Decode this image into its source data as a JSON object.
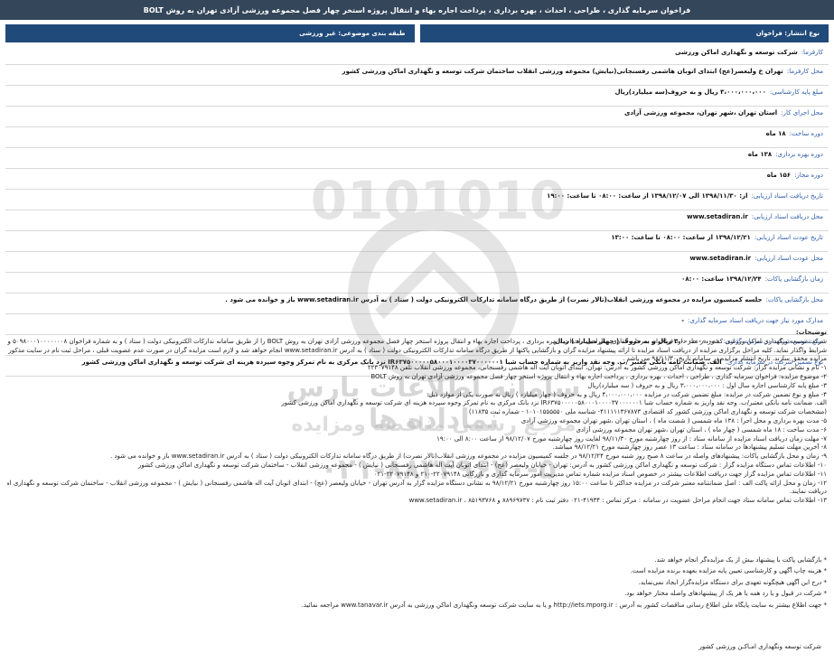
{
  "header": {
    "title": "فراخوان سرمایه گذاری ، طراحی ، احداث ، بهره برداری ، پرداخت اجاره بهاء و انتقال پروژه استخر چهار فصل مجموعه ورزشی آزادی تهران به روش BOLT"
  },
  "tabs": {
    "right": "نوع انتشار: فراخوان",
    "left": "طبقه بندی موضوعی: غیر ورزشی"
  },
  "fields": [
    {
      "label": "کارفرما:",
      "value": "شرکت توسعه و نگهداری اماکن ورزشی"
    },
    {
      "label": "محل کارفرما:",
      "value": "تهران خ ولیعصر(عج) ابتدای اتوبان هاشمی رفسنجانی(نیایش) مجموعه ورزشی انقلاب ساختمان شرکت توسعه و نگهداری اماکن ورزشی کشور"
    },
    {
      "label": "مبلغ پایه کارشناسی:",
      "value": "۳،۰۰۰،۰۰۰،۰۰۰ ریال و به حروف(سه میلیارد)ریال"
    },
    {
      "label": "محل اجرای کار:",
      "value": "استان تهران ،شهر تهران، مجموعه ورزشی آزادی"
    },
    {
      "label": "دوره ساخت:",
      "value": "۱۸ ماه"
    },
    {
      "label": "دوره بهره برداری:",
      "value": "۱۳۸ ماه"
    },
    {
      "label": "دوره مجاز:",
      "value": "۱۵۶ ماه"
    },
    {
      "label": "تاریخ دریافت اسناد ارزیابی:",
      "value": "از: ۱۳۹۸/۱۱/۳۰ الی ۱۳۹۸/۱۲/۰۷ از ساعت: ۰۸:۰۰ تا ساعت: ۱۹:۰۰"
    },
    {
      "label": "محل دریافت اسناد ارزیابی:",
      "value": "www.setadiran.ir"
    },
    {
      "label": "تاریخ عودت اسناد ارزیابی:",
      "value": "۱۳۹۸/۱۲/۲۱ از ساعت: ۰۸:۰۰ تا ساعت: ۱۳:۰۰"
    },
    {
      "label": "محل عودت اسناد ارزیابی:",
      "value": "www.setadiran.ir"
    },
    {
      "label": "زمان بازگشایی پاکات:",
      "value": "۱۳۹۸/۱۲/۲۴ ساعت: ۰۸:۰۰"
    },
    {
      "label": "محل بازگشایی پاکات:",
      "value": "جلسه کمیسیون مزایده در مجموعه ورزشی انقلاب(تالار نصرت) از طریق درگاه سامانه تدارکات الکترونیکی دولت ( ستاد ) به آدرس www.setadiran.ir باز و خوانده می شود ."
    },
    {
      "label": "مدارک مورد نیاز جهت دریافت اسناد سرمایه گذاری:",
      "value": "-"
    },
    {
      "label": "مبلغ تضمین شرکت در سرمایه گذاری:",
      "value": "۳،۰۰۰،۰۰۰،۰۰۰ ریال و به حروف ( چهار میلیارد ) ریال"
    },
    {
      "label": "نوع تضمین شرکت در سرمایه گذاری:",
      "value": "الف. ضمانت نامه بانکی معتبر /ب. وجه نقد واریز به شماره حساب شبا IR۶۳۷۵۰۰۰۰۰۵۸۰۰۰۱۰۰۰۰۳۷۰۰۰۰۰۰۱ نزد بانک مرکزی به نام تمرکز وجوه سپرده هزینه ای شرکت توسعه و نگهداری اماکن ورزشی کشور"
    }
  ],
  "body": {
    "heading": "توضیحات:",
    "paragraphs": [
      "شرکت توسعه ونگهداری اماکن ورزشی کشور در نظر دارد فراخوان سرمایه گذاری ، طراحی ، احداث ، بهره برداری ، پرداخت اجاره بهاء و انتقال پروژه استخر چهار فصل مجموعه ورزشی آزادی تهران به روش BOLT را از طریق سامانه تدارکات الکترونیکی دولت ( ستاد ) و به شماره فراخوان ۵۰۹۸۰۰۰۱۰۰۰۰۰۰۰۸ و طی تشریفات قانونی مزایده به اشخاص(حقیقی،حقوقی) واجد",
      "شرایط واگذار نماید. کلیه مراحل برگزاری مزایده از دریافت اسناد مزایده تا ارائه پیشنهاد مزایده گران و بازگشایی پاکتها از طریق درگاه سامانه تدارکات الکترونیکی دولت ( ستاد ) به آدرس www.setadiran.ir انجام خواهد شد و لازم است مزایده گران در صورت عدم عضویت قبلی ، مراحل ثبت نام در سایت مذکور و دریافت گواهی امضای الکترونیکی را جهت شرکت در",
      "مزایده محقق سازند. تاریخ انتشار مزایده در سامانه تاریخ ۹۸/۱۱/۳۰ می باشد .",
      "۱- نام و نشانی مزایده گزار: شرکت توسعه و نگهداری اماکن ورزشی کشور به آدرس: تهران، ابتدای اتوبان آیت اله هاشمی رفسنجانی، مجموعه ورزشی انقلاب تلفن ۲۲۳۰۷۹۱۴۸",
      "۲- موضوع مزایده: فراخوان سرمایه گذاری ، طراحی ، احداث ، بهره برداری ، پرداخت اجاره بهاء و انتقال پروژه استخر چهار فصل مجموعه ورزشی آزادی تهران به روش BOLT",
      "۳- مبلغ پایه کارشناسی اجاره سال اول : ۳،۰۰۰،۰۰۰،۰۰۰ ریال و به حروف ( سه میلیارد)ریال",
      "۴- مبلغ و نوع تضمین شرکت در مزایده: مبلغ تضمین شرکت در مزایده ۴،۰۰۰،۰۰۰،۰۰۰ ریال و به حروف ( چهار میلیارد ) ریال به صورت یکی از موارد ذیل:",
      "الف. ضمانت نامه بانکی معتبر/ب. وجه نقد واریز به شماره حساب شبا IR۶۳۷۵۰۰۰۰۰۵۸۰۰۰۱۰۰۰۰۳۷۰۰۰۰۰۰۱ نزد بانک مرکزی به نام تمرکز وجوه سپرده هزینه ای شرکت توسعه و نگهداری اماکن ورزشی کشور",
      "(مشخصات شرکت توسعه و نگهداری اماکن ورزشی کشور کد اقتصادی ۴۱۱۱۱۱۳۶۷۸۷۳- شناسه ملی ۱۰۱۰۱۵۵۵۵۵۰ - شماره ثبت ۱۱۸۳۵)",
      "۵- مدت بهره برداری و محل اجرا : ۱۳۸ ماه شمسی ( شصت ماه ) ، استان تهران ،شهر تهران مجموعه ورزشی آزادی",
      "۶- مدت ساخت : ۱۸ ماه شمسی ( چهار ماه ) ، استان تهران ،شهر تهران مجموعه ورزشی آزادی",
      "۷- مهلت زمان دریافت اسناد مزایده از سامانه ستاد : از روز چهارشنبه مورخ ۹۸/۱۱/۳۰ لغایت روز چهارشنبه مورخ ۹۸/۱۲/۰۷ از ساعت ۸:۰۰ الی ۱۹:۰۰",
      "۸- آخرین مهلت تسلیم پیشنهادها در سامانه ستاد : ساعت ۱۳ عصر روز چهارشنبه مورخ ۹۸/۱۲/۲۱ میباشد.",
      "۹- زمان و محل بازگشایی پاکات: پیشنهادهای واصله در ساعت ۸ صبح روز شنبه مورخ ۹۸/۱۲/۲۴ در جلسه کمیسیون مزایده در مجموعه ورزشی انقلاب(تالار نصرت) از طریق درگاه سامانه تدارکات الکترونیکی دولت ( ستاد ) به آدرس www.setadiran.ir باز و خوانده می شود .",
      "۱۰- اطلاعات تماس دستگاه مزایده گزار : شرکت توسعه و نگهداری اماکن ورزشی کشور به آدرس: تهران - خیابان ولیعصر (عج) - ابتدای اتوبان آیت اله هاشمی رفسنجانی ( نیایش ) - مجموعه ورزشی انقلاب - ساختمان شرکت توسعه و نگهداری اماکن ورزشی کشور",
      "۱۱- اطلاعات تماس مزایده گزار جهت دریافت اطلاعات بیشتر در خصوص اسناد مزایده شماره تماس مدیریت امور سرمایه گذاری و بازرگانی ۲۲۰۷۹۱۴۸-۲۱۰ و ۲۲۰۷۹۱۴۸-۰۲۱",
      "۱۲- زمان و محل ارائه پاکت الف : اصل ضمانتنامه معتبر شرکت در مزایده حداکثر تا ساعت ۱۵:۰۰ روز چهارشنبه مورخ ۹۸/۱۲/۲۱ به نشانی دستگاه مزایده گزار به آدرس تهران - خیابان ولیعصر (عج) - ابتدای اتوبان آیت اله هاشمی رفسنجانی ( نیایش ) - مجموعه ورزشی انقلاب - ساختمان شرکت توسعه و نگهداری اماکن ورزشی دبیرخانه تسلیم نموده و رسید آن را",
      "دریافت نمایند.",
      "۱۳- اطلاعات تماس سامانه ستاد جهت انجام مراحل عضویت در سامانه : مرکز تماس : ۴۱۹۳۴-۰۲۱ دفتر ثبت نام : ۸۸۹۶۹۷۳۷ و ۸۵۱۹۳۷۶۸ ، www.setadiran.ir"
    ]
  },
  "notes": [
    "* بازگشایی پاکت با پیشنهاد بیش از یک مزایده‌گر انجام خواهد شد.",
    "* هزینه چاپ آگهی و کارشناسی تعیین پایه مزایده بعهده برنده مزایده است.",
    "* درج این آگهی هیچگونه تعهدی برای دستگاه مزایده‌گزار ایجاد نمی‌نماید.",
    "* شرکت در قبول و یا رد همه یا هر یک از پیشنهادهای واصله مختار خواهد بود.",
    "* جهت اطلاع بیشتر به سایت پایگاه ملی اطلاع رسانی مناقصات کشور به آدرس : http://iets.mporg.ir و یا به سایت شرکت توسعه ونگهداری اماکن ورزشی به آدرس www.tanavar.ir مراجعه نمائید."
  ],
  "footer": {
    "signature": "شرکت توسعه ونگهداری امـاکـن ورزشی کشور"
  },
  "watermark": {
    "logo_digits": "0101010",
    "line1": "سامانه اطلاعات پارس نماداده ها",
    "line2": "مرجع رسمی مناقصه ومزایده",
    "phone": "۰۲۱-۸۸۳۴۹۶۷۰-۵"
  },
  "colors": {
    "topbar": "#34465a",
    "tab": "#204a7a",
    "label": "#2a5aa8"
  }
}
